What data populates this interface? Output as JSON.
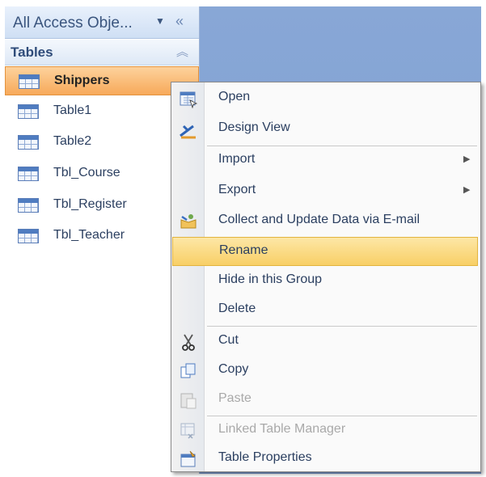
{
  "nav": {
    "title": "All Access Obje...",
    "dropdown_icon": "dropdown-arrow-icon",
    "collapse_icon": "double-chevron-left-icon",
    "group": {
      "label": "Tables",
      "chevron_icon": "double-chevron-up-icon"
    },
    "items": [
      {
        "label": "Shippers",
        "selected": true
      },
      {
        "label": "Table1"
      },
      {
        "label": "Table2"
      },
      {
        "label": "Tbl_Course"
      },
      {
        "label": "Tbl_Register"
      },
      {
        "label": "Tbl_Teacher"
      }
    ]
  },
  "menu": {
    "open": "Open",
    "design_view": "Design View",
    "import": "Import",
    "export": "Export",
    "collect": "Collect and Update Data via E-mail",
    "rename": "Rename",
    "hide": "Hide in this Group",
    "delete": "Delete",
    "cut": "Cut",
    "copy": "Copy",
    "paste": "Paste",
    "linked": "Linked Table Manager",
    "properties": "Table Properties"
  },
  "colors": {
    "selection": "#f7a95a",
    "menu_highlight": "#f8cf66",
    "workspace": "#7f9fd2"
  }
}
